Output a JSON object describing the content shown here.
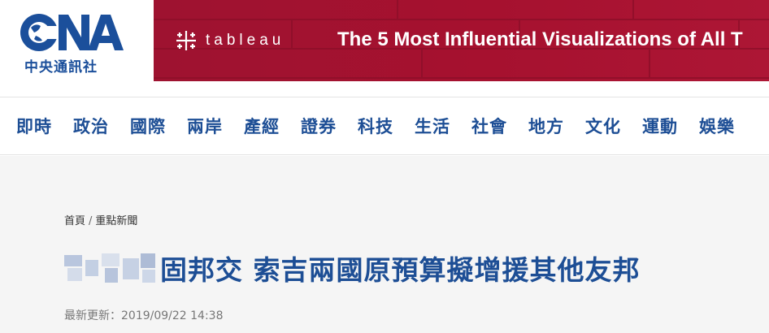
{
  "logo": {
    "wordmark": "CNA",
    "org_name": "中央通訊社"
  },
  "ad": {
    "brand": "tableau",
    "headline": "The 5 Most Influential Visualizations of All T"
  },
  "nav": {
    "items": [
      "即時",
      "政治",
      "國際",
      "兩岸",
      "產經",
      "證券",
      "科技",
      "生活",
      "社會",
      "地方",
      "文化",
      "運動",
      "娛樂"
    ]
  },
  "breadcrumb": {
    "home": "首頁",
    "separator": "/",
    "section": "重點新聞"
  },
  "article": {
    "title": "固邦交 索吉兩國原預算擬增援其他友邦",
    "updated_label": "最新更新：",
    "updated_time": "2019/09/22 14:38"
  },
  "colors": {
    "brand_blue": "#1d4e95",
    "ad_red": "#a6112f",
    "content_bg": "#f5f5f5"
  }
}
